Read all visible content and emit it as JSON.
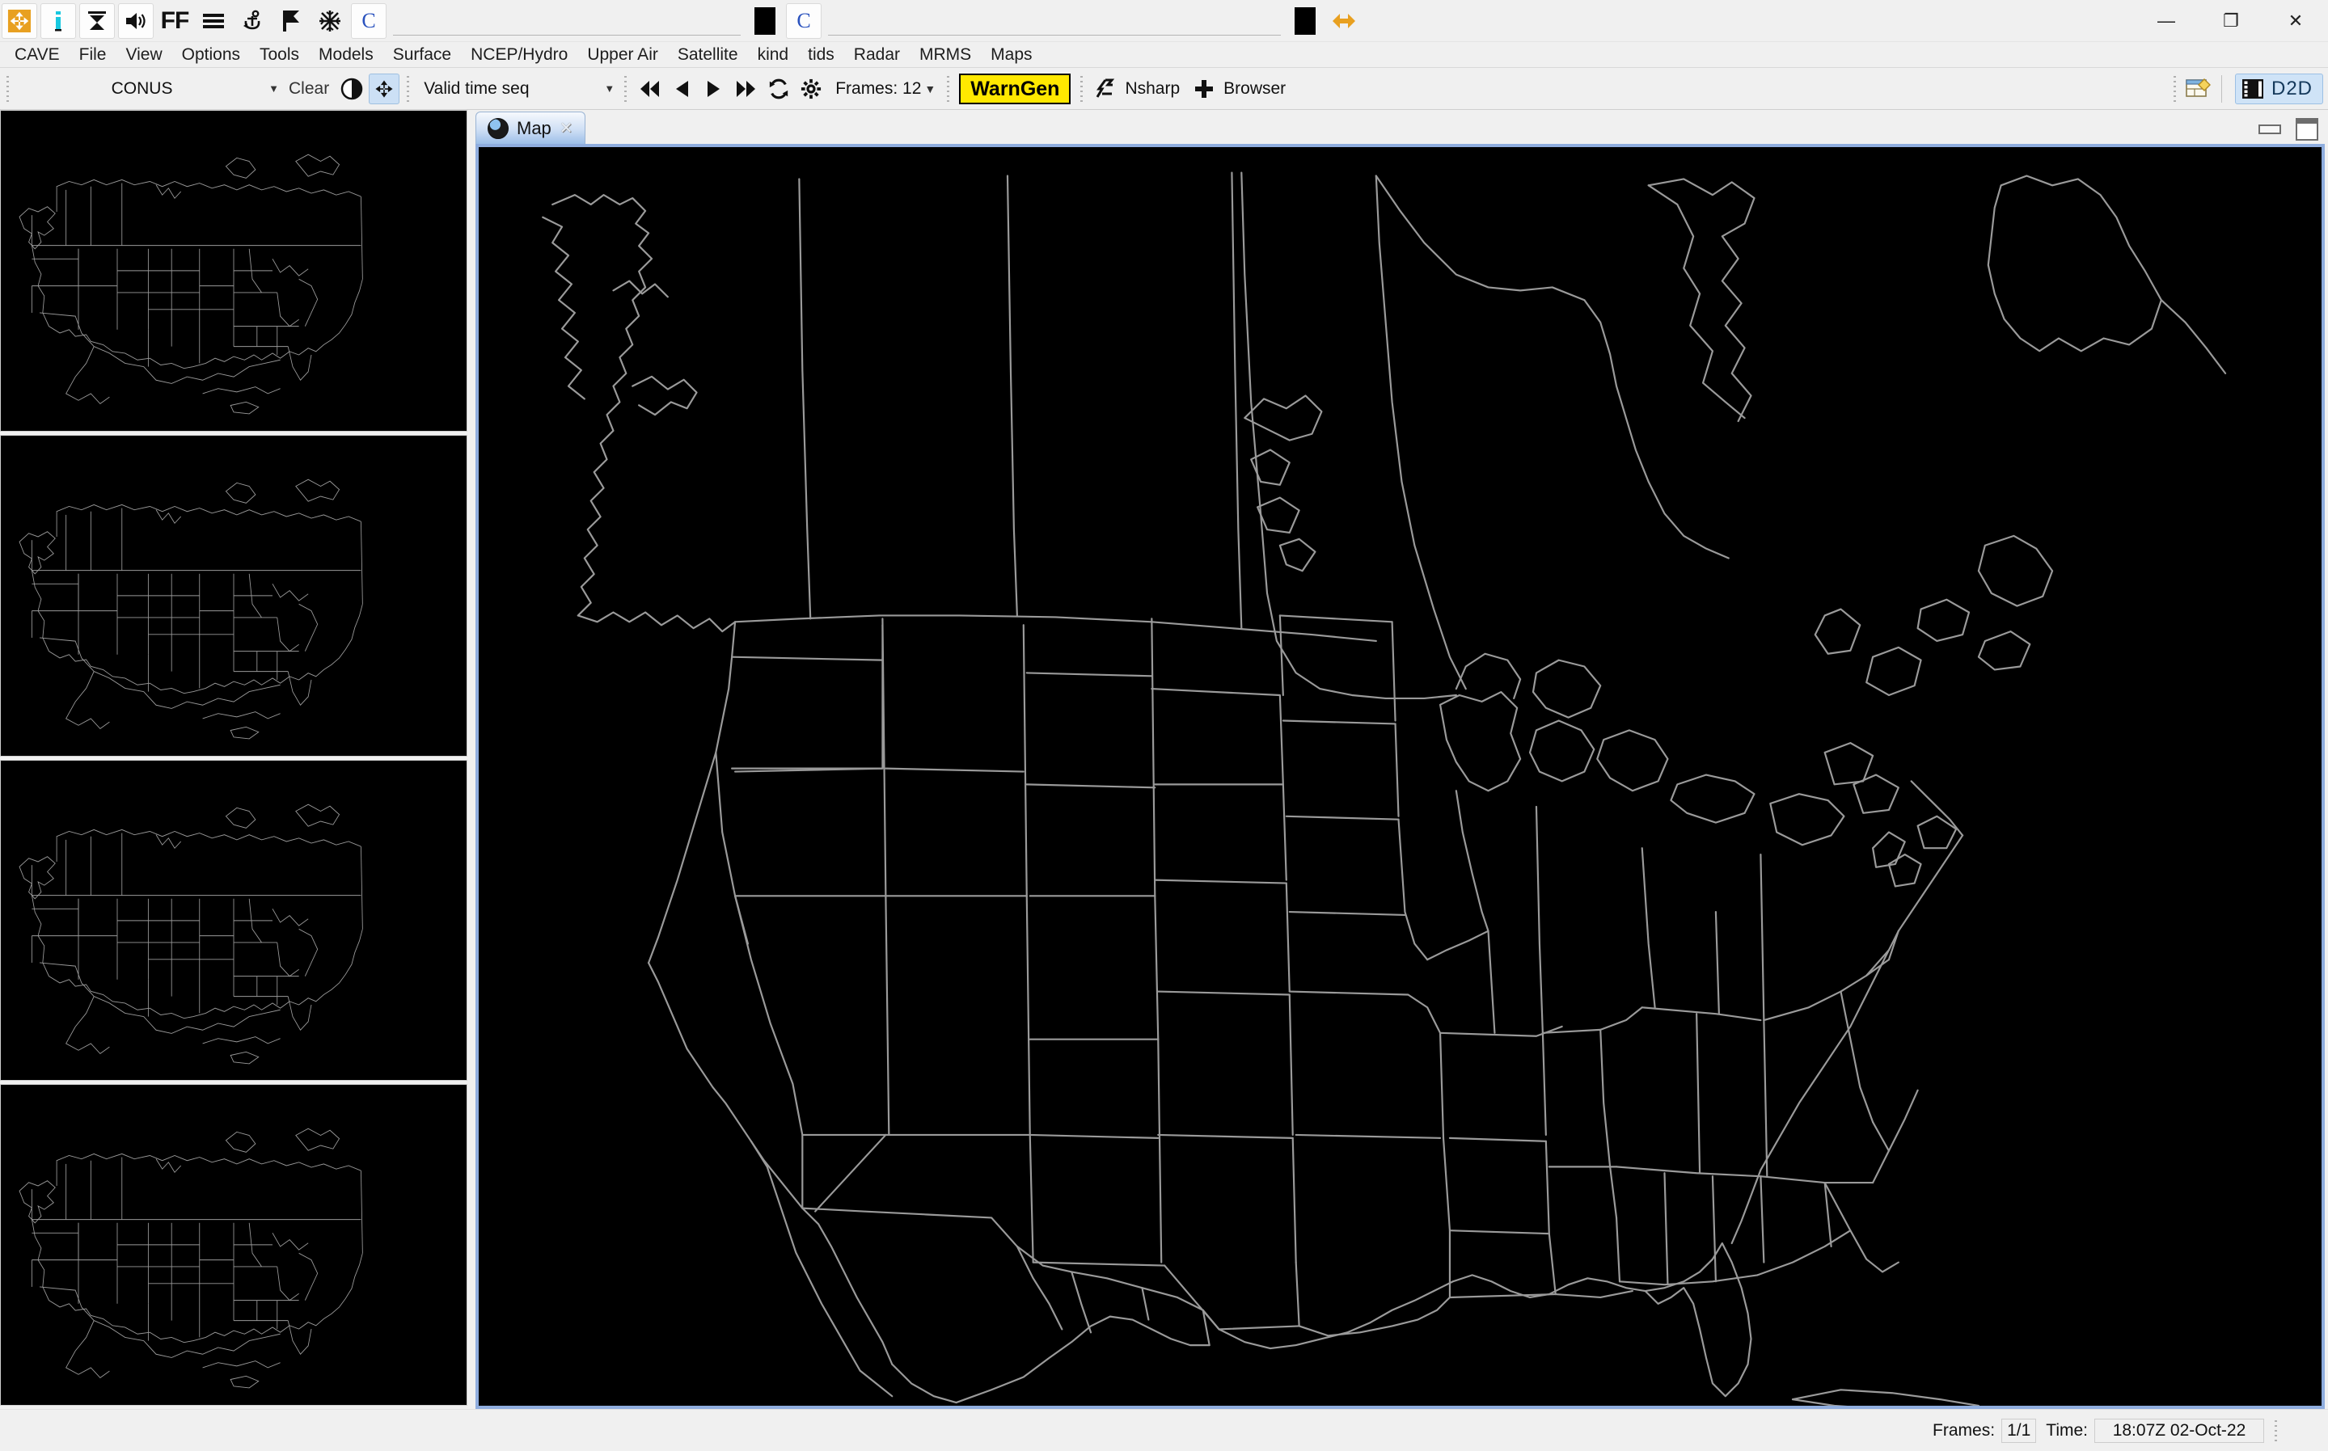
{
  "window": {
    "minimize": "—",
    "maximize": "❐",
    "close": "✕"
  },
  "top_toolbar": {
    "buttons": [
      {
        "name": "move-arrows-icon",
        "glyph": "✥"
      },
      {
        "name": "info-icon",
        "glyph": "i"
      },
      {
        "name": "hourglass-icon",
        "glyph": "⧖"
      },
      {
        "name": "speaker-icon",
        "glyph": "🔊"
      },
      {
        "name": "ff-icon",
        "glyph": "FF"
      },
      {
        "name": "list-lines-icon",
        "glyph": "☰"
      },
      {
        "name": "anchor-icon",
        "glyph": "⚓"
      },
      {
        "name": "flag-icon",
        "glyph": "⚑"
      },
      {
        "name": "snowflake-icon",
        "glyph": "❄"
      }
    ],
    "c_label": "C",
    "field1_value": "",
    "field1_placeholder": "",
    "field2_value": "",
    "field2_placeholder": "",
    "swap_icon": "⬌"
  },
  "menubar": {
    "items": [
      "CAVE",
      "File",
      "View",
      "Options",
      "Tools",
      "Models",
      "Surface",
      "NCEP/Hydro",
      "Upper Air",
      "Satellite",
      "kind",
      "tids",
      "Radar",
      "MRMS",
      "Maps"
    ]
  },
  "toolbar2": {
    "scale_combo": "CONUS",
    "clear_label": "Clear",
    "contrast_icon": "◐",
    "fit_icon": "✥",
    "time_combo": "Valid time seq",
    "nav": {
      "first": "⏮",
      "prev": "◀",
      "next": "▶",
      "last": "⏭",
      "loop": "⟳",
      "settings": "⚙"
    },
    "frames_label": "Frames: 12",
    "warngen_label": "WarnGen",
    "nsharp_label": "Nsharp",
    "browser_label": "Browser",
    "new_window_icon": "window-icon",
    "perspective_label": "D2D"
  },
  "editor": {
    "tab": {
      "icon": "globe-icon",
      "label": "Map",
      "close": "✕"
    },
    "minimize_tooltip": "Minimize",
    "maximize_tooltip": "Maximize"
  },
  "thumbnails": [
    {
      "name": "thumbnail-pane-1"
    },
    {
      "name": "thumbnail-pane-2"
    },
    {
      "name": "thumbnail-pane-3"
    },
    {
      "name": "thumbnail-pane-4"
    }
  ],
  "statusbar": {
    "frames_label": "Frames:",
    "frames_value": "1/1",
    "time_label": "Time:",
    "time_value": "18:07Z 02-Oct-22"
  },
  "colors": {
    "accent": "#ffe800",
    "selection": "#cce0f5",
    "viewport_border": "#8fadde",
    "map_line": "#9a9a9a",
    "background": "#000000"
  }
}
